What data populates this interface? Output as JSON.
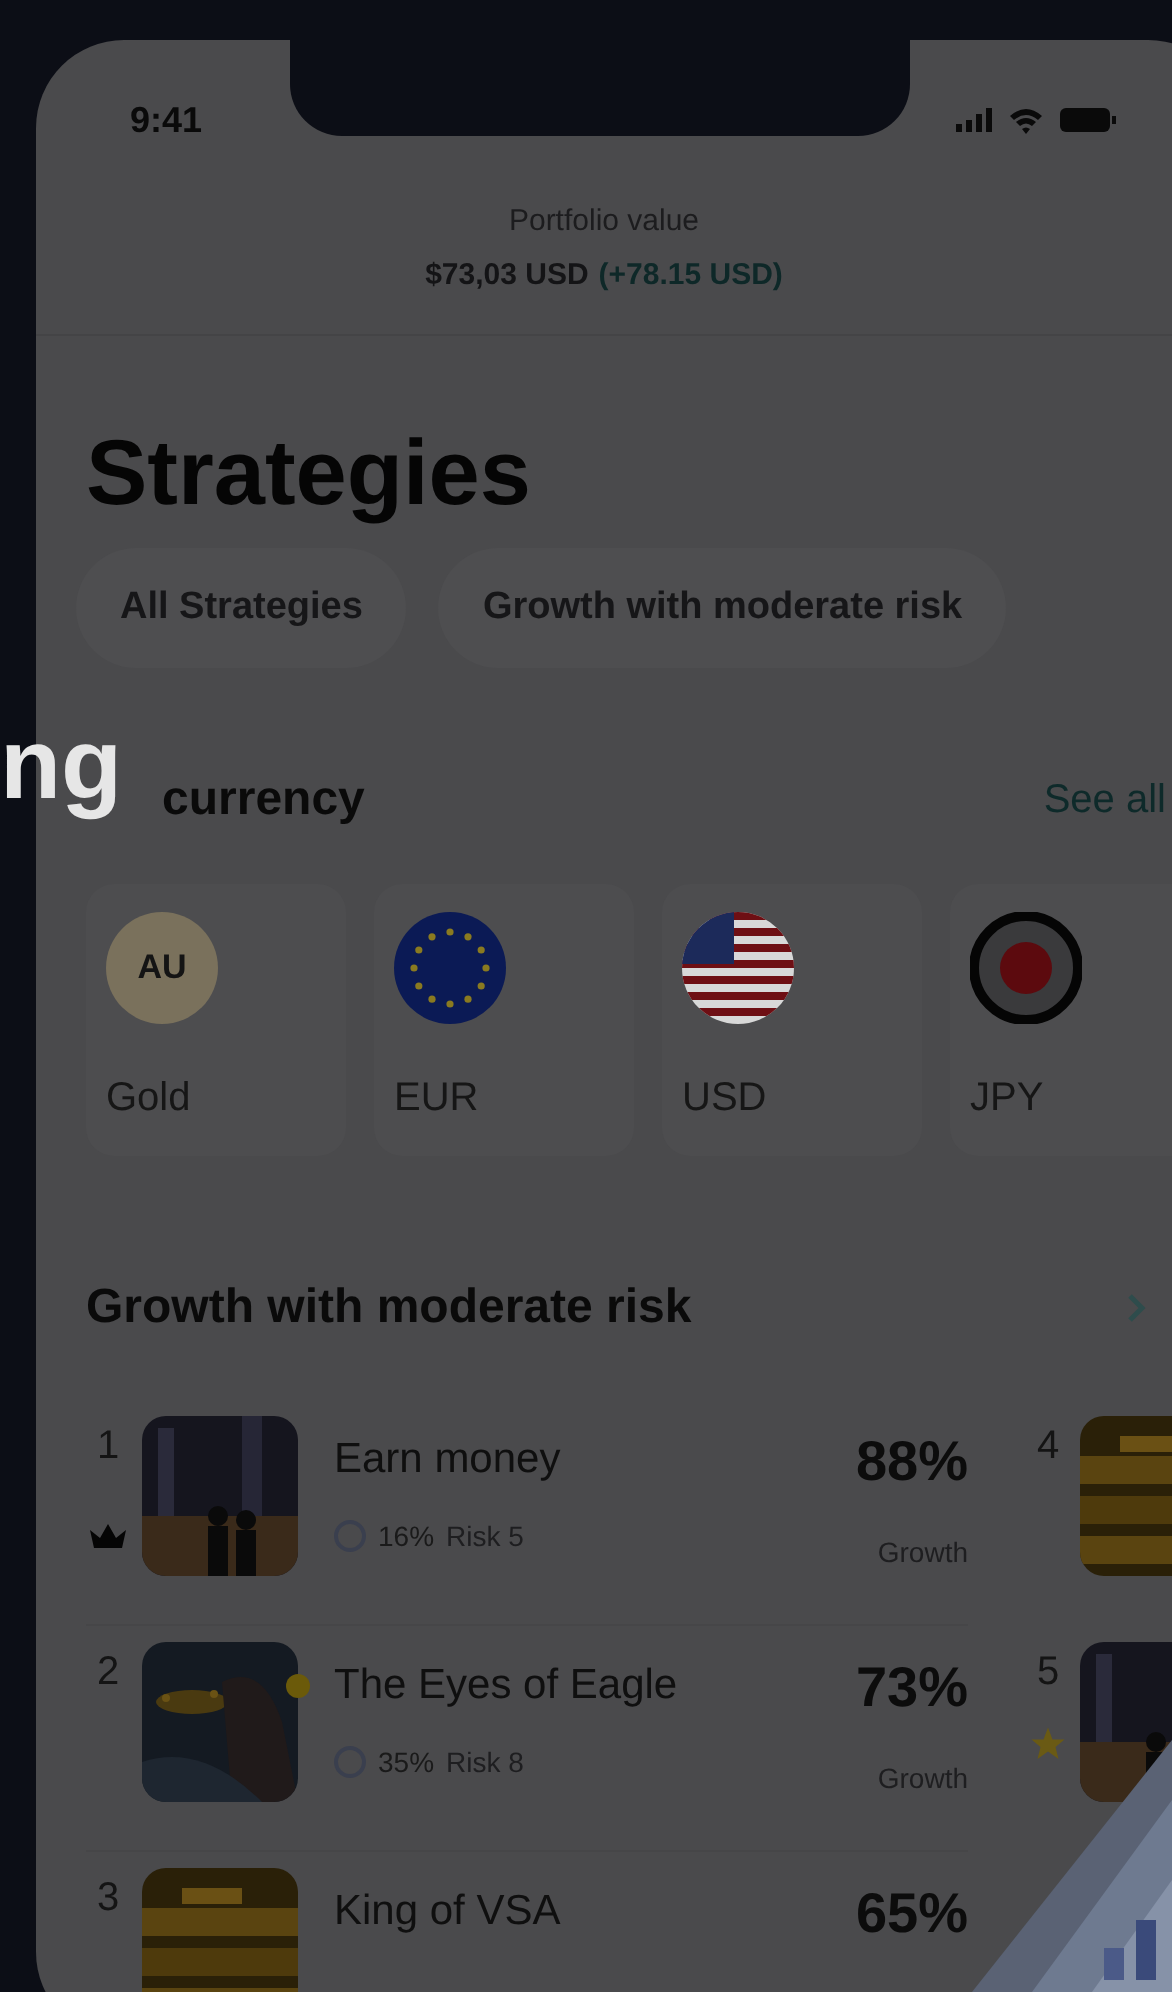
{
  "status_bar": {
    "time": "9:41"
  },
  "portfolio": {
    "label": "Portfolio value",
    "value": "$73,03 USD",
    "change": "(+78.15 USD)"
  },
  "title": "Strategies",
  "filters": [
    {
      "label": "All Strategies"
    },
    {
      "label": "Growth with moderate risk"
    }
  ],
  "overlay_text": "ng",
  "currency_section": {
    "title": "currency",
    "link": "See all",
    "items": [
      {
        "name": "Gold",
        "kind": "gold",
        "code": "AU"
      },
      {
        "name": "EUR",
        "kind": "eu"
      },
      {
        "name": "USD",
        "kind": "us"
      },
      {
        "name": "JPY",
        "kind": "jp"
      }
    ]
  },
  "strategy_section": {
    "title": "Growth with moderate risk",
    "items": [
      {
        "rank": "1",
        "name": "Earn money",
        "return": "16%",
        "risk": "Risk 5",
        "growth": "88%",
        "growth_label": "Growth",
        "crowned": true,
        "dot": false
      },
      {
        "rank": "2",
        "name": "The Eyes of Eagle",
        "return": "35%",
        "risk": "Risk 8",
        "growth": "73%",
        "growth_label": "Growth",
        "crowned": false,
        "dot": true
      },
      {
        "rank": "3",
        "name": "King of VSA",
        "growth": "65%",
        "crowned": false,
        "dot": false
      }
    ],
    "side_items": [
      {
        "rank": "4",
        "starred": false
      },
      {
        "rank": "5",
        "starred": true
      }
    ]
  }
}
